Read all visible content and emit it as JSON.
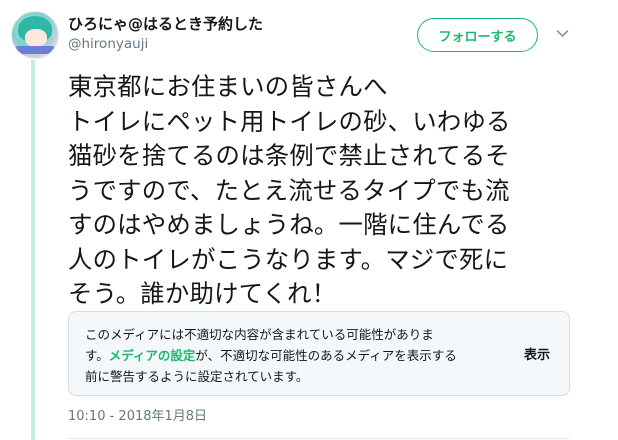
{
  "user": {
    "display_name": "ひろにゃ@はるとき予約した",
    "handle": "@hironyauji",
    "avatar_icon": "user-avatar"
  },
  "follow_button": {
    "label": "フォローする",
    "color": "#1db76f"
  },
  "menu_icon": "chevron-down-icon",
  "tweet": {
    "lines": [
      "東京都にお住まいの皆さんへ",
      "トイレにペット用トイレの砂、いわゆる",
      "猫砂を捨てるのは条例で禁止されてるそ",
      "うですので、たとえ流せるタイプでも流",
      "すのはやめましょうね。一階に住んでる",
      "人のトイレがこうなります。マジで死に",
      "そう。誰か助けてくれ！"
    ]
  },
  "media_warning": {
    "line1": "このメディアには不適切な内容が含まれている可能性がありま",
    "line2_pre": "す。",
    "settings_link": "メディアの設定",
    "line2_post": "が、不適切な可能性のあるメディアを表示する",
    "line3": "前に警告するように設定されています。",
    "show_button": "表示"
  },
  "timestamp": "10:10 - 2018年1月8日",
  "colors": {
    "accent": "#1db76f",
    "thread_line": "#c4eede",
    "muted": "#657786"
  }
}
